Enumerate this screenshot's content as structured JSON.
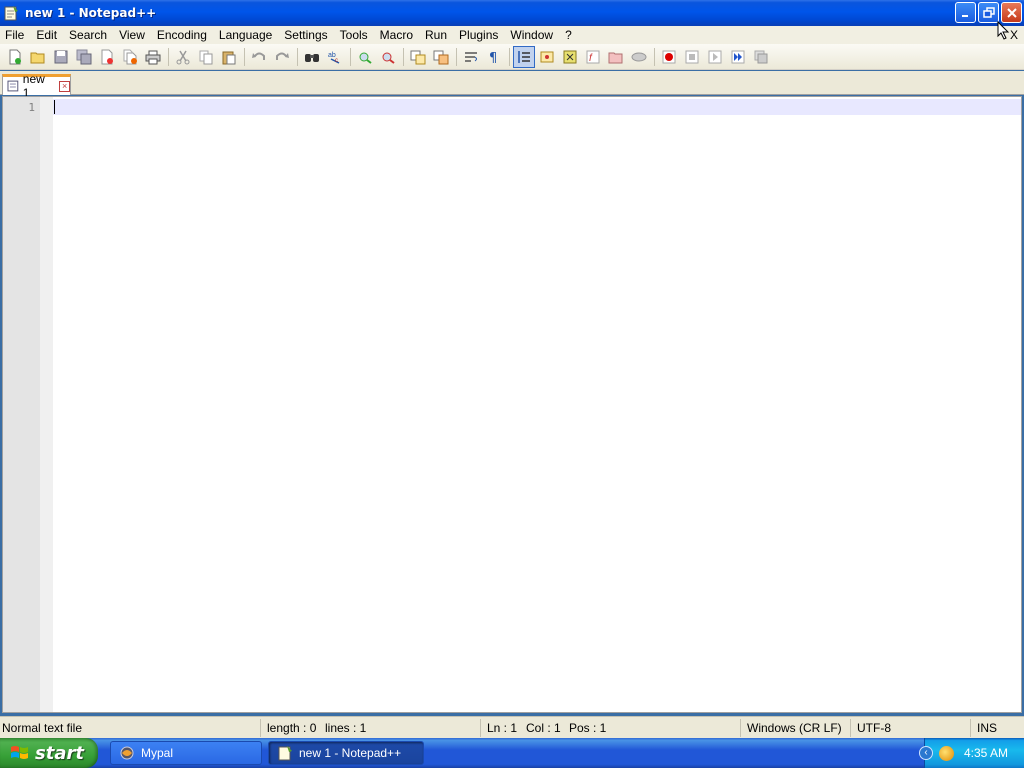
{
  "window": {
    "title": "new 1 - Notepad++",
    "controls": {
      "minimize": "_",
      "maximize": "❐",
      "close": "✕"
    }
  },
  "menu": {
    "items": [
      "File",
      "Edit",
      "Search",
      "View",
      "Encoding",
      "Language",
      "Settings",
      "Tools",
      "Macro",
      "Run",
      "Plugins",
      "Window",
      "?"
    ],
    "close_doc": "X"
  },
  "toolbar": {
    "buttons": [
      "new",
      "open",
      "save",
      "save-all",
      "close",
      "close-all",
      "print",
      "cut",
      "copy",
      "paste",
      "undo",
      "redo",
      "find",
      "replace",
      "zoom-in",
      "zoom-out",
      "sync-vertical",
      "sync-horizontal",
      "wrap",
      "show-all-chars",
      "indent-guide",
      "user-lang",
      "doc-map",
      "function-list",
      "folder-workspace",
      "monitoring",
      "record-macro",
      "stop-record",
      "play-macro",
      "run-macro-multiple",
      "save-macro"
    ]
  },
  "tabs": [
    {
      "label": "new 1",
      "close": "×"
    }
  ],
  "editor": {
    "line_numbers": [
      "1"
    ],
    "content": ""
  },
  "statusbar": {
    "file_type": "Normal text file",
    "length": "length : 0",
    "lines": "lines : 1",
    "ln": "Ln : 1",
    "col": "Col : 1",
    "pos": "Pos : 1",
    "eol": "Windows (CR LF)",
    "encoding": "UTF-8",
    "mode": "INS"
  },
  "taskbar": {
    "start_label": "start",
    "tasks": [
      {
        "label": "Mypal",
        "active": false
      },
      {
        "label": "new 1 - Notepad++",
        "active": true
      }
    ],
    "tray_chevron": "‹",
    "clock": "4:35 AM"
  },
  "colors": {
    "titlebar": "#0055ea",
    "tab_accent": "#f0a030",
    "current_line": "#e8e8ff",
    "start_button": "#37a037"
  }
}
